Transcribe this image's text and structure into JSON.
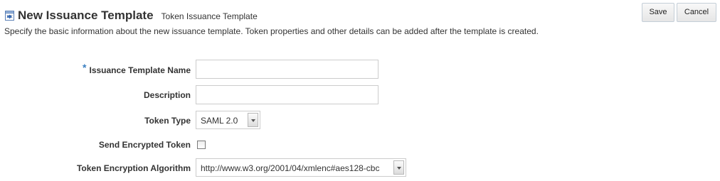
{
  "header": {
    "title": "New Issuance Template",
    "subtitle": "Token Issuance Template",
    "description": "Specify the basic information about the new issuance template. Token properties and other details can be added after the template is created."
  },
  "toolbar": {
    "save_label": "Save",
    "cancel_label": "Cancel"
  },
  "form": {
    "issuance_template_name": {
      "label": "Issuance Template Name",
      "required": true,
      "value": ""
    },
    "description": {
      "label": "Description",
      "value": ""
    },
    "token_type": {
      "label": "Token Type",
      "selected": "SAML 2.0"
    },
    "send_encrypted_token": {
      "label": "Send Encrypted Token",
      "checked": false
    },
    "token_encryption_algorithm": {
      "label": "Token Encryption Algorithm",
      "selected": "http://www.w3.org/2001/04/xmlenc#aes128-cbc"
    }
  },
  "colors": {
    "required_star": "#3a7fc1",
    "icon_accent": "#2e64b2"
  },
  "icons": {
    "title_icon": "template-document-icon",
    "dropdown_icon": "chevron-down-icon"
  }
}
